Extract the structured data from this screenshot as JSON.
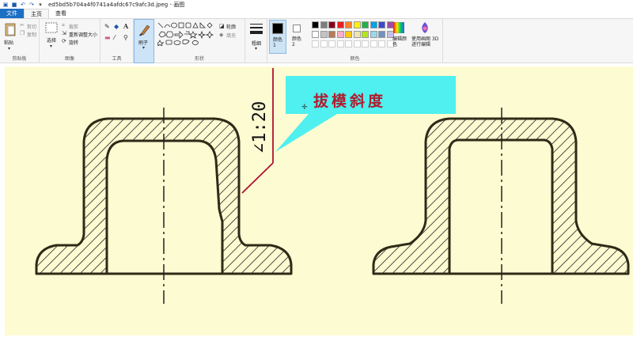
{
  "window": {
    "title": "ed5bd5b704a4f0741a4afdc67c9afc3d.jpeg - 画图"
  },
  "tabs": [
    {
      "label": "文件"
    },
    {
      "label": "主页"
    },
    {
      "label": "查看"
    }
  ],
  "ribbon": {
    "clipboard": {
      "paste": "粘贴",
      "cut": "剪切",
      "copy": "复制",
      "group": "剪贴板"
    },
    "image": {
      "select": "选择",
      "crop": "裁剪",
      "resize": "重新调整大小",
      "rotate": "旋转",
      "group": "图像"
    },
    "tools": {
      "group": "工具"
    },
    "brushes": {
      "label": "刷子"
    },
    "shapes": {
      "outline": "轮廓",
      "fill": "填充",
      "group": "形状"
    },
    "size": {
      "label": "粗细"
    },
    "colors": {
      "color1": "颜色 1",
      "color2": "颜色 2",
      "edit": "编辑颜色",
      "paint3d": "使用画图 3D 进行编辑",
      "group": "颜色",
      "palette": [
        "#000000",
        "#7f7f7f",
        "#880015",
        "#ed1c24",
        "#ff7f27",
        "#fff200",
        "#22b14c",
        "#00a2e8",
        "#3f48cc",
        "#a349a4",
        "#ffffff",
        "#c3c3c3",
        "#b97a57",
        "#ffaec9",
        "#ffc90e",
        "#efe4b0",
        "#b5e61d",
        "#99d9ea",
        "#7092be",
        "#c8bfe7"
      ]
    }
  },
  "drawing": {
    "callout": "拔模斜度",
    "taper": "∠1:20",
    "background": "#fdfbd2",
    "callout_color": "#4ff0ef"
  }
}
